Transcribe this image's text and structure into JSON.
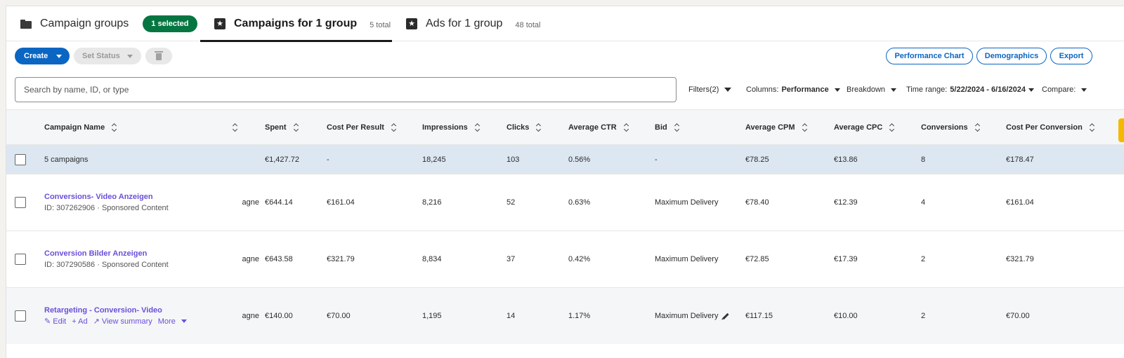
{
  "tabs": [
    {
      "label": "Campaign groups",
      "icon": "folder-icon",
      "badge": "1 selected"
    },
    {
      "label": "Campaigns for 1 group",
      "icon": "star-icon",
      "count": "5 total"
    },
    {
      "label": "Ads for 1 group",
      "icon": "star-icon",
      "count": "48 total"
    }
  ],
  "toolbar": {
    "create_label": "Create",
    "set_status_label": "Set Status",
    "performance_chart_label": "Performance Chart",
    "demographics_label": "Demographics",
    "export_label": "Export"
  },
  "search": {
    "placeholder": "Search by name, ID, or type"
  },
  "controls": {
    "filters_label": "Filters(2)",
    "columns_label": "Columns:",
    "columns_value": "Performance",
    "breakdown_label": "Breakdown",
    "time_range_label": "Time range:",
    "time_range_value": "5/22/2024 - 6/16/2024",
    "compare_label": "Compare:"
  },
  "table": {
    "headers": {
      "name": "Campaign Name",
      "spent": "Spent",
      "cost_per_result": "Cost Per Result",
      "impressions": "Impressions",
      "clicks": "Clicks",
      "average_ctr": "Average CTR",
      "bid": "Bid",
      "average_cpm": "Average CPM",
      "average_cpc": "Average CPC",
      "conversions": "Conversions",
      "cost_per_conversion": "Cost Per Conversion"
    },
    "summary": {
      "name": "5 campaigns",
      "spent": "€1,427.72",
      "cost_per_result": "-",
      "impressions": "18,245",
      "clicks": "103",
      "average_ctr": "0.56%",
      "bid": "-",
      "average_cpm": "€78.25",
      "average_cpc": "€13.86",
      "conversions": "8",
      "cost_per_conversion": "€178.47"
    },
    "rows": [
      {
        "name": "Conversions- Video Anzeigen",
        "sub": "ID: 307262906 · Sponsored Content",
        "objective": "agne",
        "spent": "€644.14",
        "cost_per_result": "€161.04",
        "impressions": "8,216",
        "clicks": "52",
        "average_ctr": "0.63%",
        "bid": "Maximum Delivery",
        "average_cpm": "€78.40",
        "average_cpc": "€12.39",
        "conversions": "4",
        "cost_per_conversion": "€161.04"
      },
      {
        "name": "Conversion Bilder Anzeigen",
        "sub": "ID: 307290586 · Sponsored Content",
        "objective": "agne",
        "spent": "€643.58",
        "cost_per_result": "€321.79",
        "impressions": "8,834",
        "clicks": "37",
        "average_ctr": "0.42%",
        "bid": "Maximum Delivery",
        "average_cpm": "€72.85",
        "average_cpc": "€17.39",
        "conversions": "2",
        "cost_per_conversion": "€321.79"
      },
      {
        "name": "Retargeting - Conversion- Video",
        "actions": {
          "edit": "✎ Edit",
          "ad": "+ Ad",
          "summary": "↗ View summary",
          "more": "More"
        },
        "objective": "agne",
        "spent": "€140.00",
        "cost_per_result": "€70.00",
        "impressions": "1,195",
        "clicks": "14",
        "average_ctr": "1.17%",
        "bid": "Maximum Delivery",
        "average_cpm": "€117.15",
        "average_cpc": "€10.00",
        "conversions": "2",
        "cost_per_conversion": "€70.00"
      }
    ]
  },
  "colors": {
    "primary": "#0a66c2",
    "badge": "#057642",
    "link": "#6b4fd8",
    "summary_bg": "#dde7f1"
  }
}
